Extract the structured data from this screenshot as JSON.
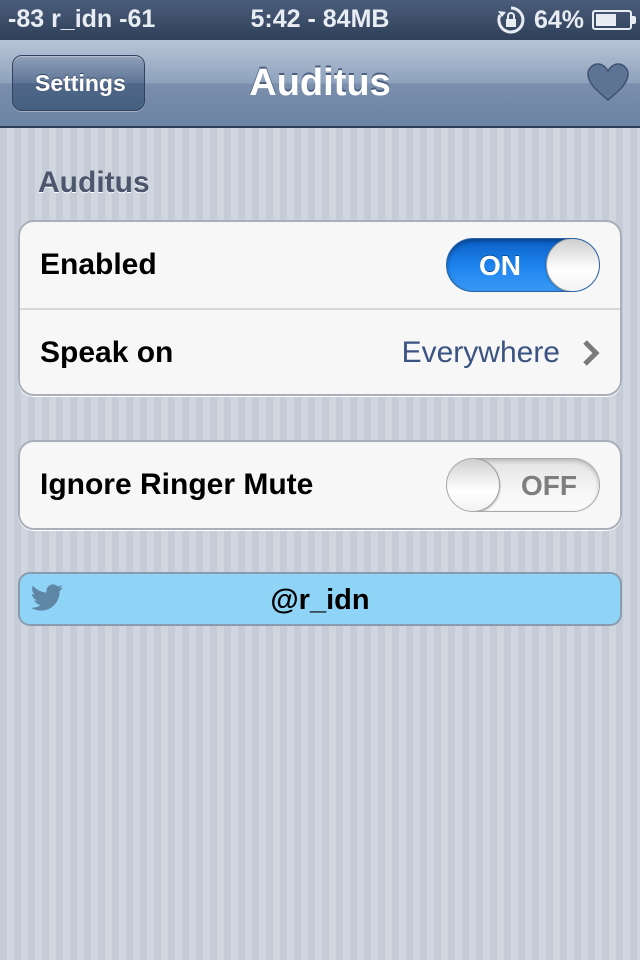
{
  "status_bar": {
    "left": "-83 r_idn  -61",
    "center": "5:42 - 84MB",
    "battery_percent": "64%",
    "battery_level": 0.64,
    "icons": [
      "rotation-lock-icon",
      "battery-charging-icon"
    ]
  },
  "nav": {
    "back_label": "Settings",
    "title": "Auditus",
    "right_icon": "heart-icon"
  },
  "section": {
    "header": "Auditus"
  },
  "group1": {
    "enabled": {
      "label": "Enabled",
      "switch_state": "ON",
      "on": true
    },
    "speak_on": {
      "label": "Speak on",
      "value": "Everywhere"
    }
  },
  "group2": {
    "ignore_ringer": {
      "label": "Ignore Ringer Mute",
      "switch_state": "OFF",
      "on": false
    }
  },
  "twitter": {
    "handle": "@r_idn",
    "icon": "twitter-bird-icon"
  },
  "colors": {
    "switch_on": "#1f86f0",
    "twitter_bg": "#8fd4f6",
    "value_text": "#3b5380"
  }
}
